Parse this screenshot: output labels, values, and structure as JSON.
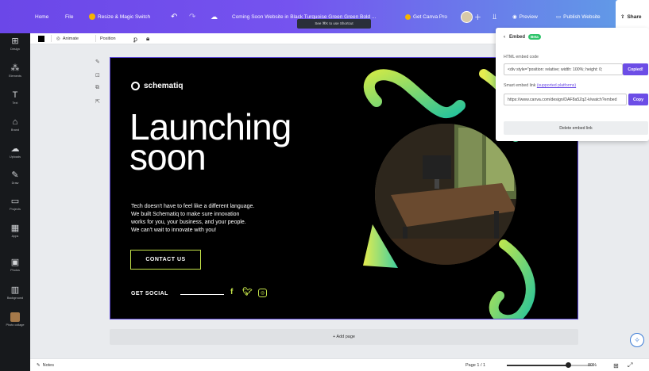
{
  "topbar": {
    "home": "Home",
    "file": "File",
    "resize": "Resize & Magic Switch",
    "title": "Coming Soon Website in Black Turquoise Green Green Bold ...",
    "canva_pro": "Get Canva Pro",
    "preview": "Preview",
    "publish": "Publish Website",
    "share": "Share",
    "tooltip": "See ⌘K to use Shortcut",
    "colors": {
      "start": "#6b47e8",
      "end": "#5fa0e6"
    }
  },
  "sidebar": {
    "items": [
      {
        "label": "Design",
        "icon": "design-icon",
        "glyph": "⊞"
      },
      {
        "label": "Elements",
        "icon": "elements-icon",
        "glyph": "⁂"
      },
      {
        "label": "Text",
        "icon": "text-icon",
        "glyph": "T"
      },
      {
        "label": "Brand",
        "icon": "brand-icon",
        "glyph": "⌂"
      },
      {
        "label": "Uploads",
        "icon": "uploads-icon",
        "glyph": "☁"
      },
      {
        "label": "Draw",
        "icon": "draw-icon",
        "glyph": "✎"
      },
      {
        "label": "Projects",
        "icon": "projects-icon",
        "glyph": "▭"
      },
      {
        "label": "Apps",
        "icon": "apps-icon",
        "glyph": "▦"
      },
      {
        "label": "Photos",
        "icon": "photos-icon",
        "glyph": "▣"
      },
      {
        "label": "Background",
        "icon": "background-icon",
        "glyph": "▥"
      },
      {
        "label": "Photo collage",
        "icon": "photo-collage-icon",
        "glyph": ""
      }
    ]
  },
  "toolbar": {
    "animate": "Animate",
    "position": "Position",
    "color": "#000000"
  },
  "canvas": {
    "brand": "schematiq",
    "headline": [
      "Launching",
      "soon"
    ],
    "body": [
      "Tech doesn't have to feel like a different language.",
      "We built Schematiq to make sure innovation",
      "works for you, your business, and your people.",
      "We can't wait to innovate with you!"
    ],
    "cta": "CONTACT US",
    "social_label": "GET SOCIAL",
    "accent": "#c5e54a"
  },
  "addpage": "+ Add page",
  "bottombar": {
    "notes": "Notes",
    "page": "Page 1 / 1",
    "zoom": "80%",
    "zoom_fraction": 0.7
  },
  "embed": {
    "title": "Embed",
    "badge": "Beta",
    "html_label": "HTML embed code",
    "html_value": "<div style=\"position: relative; width: 100%; height: 0;",
    "html_button": "Copied!",
    "link_label": "Smart embed link",
    "link_hint": "(supported platforms)",
    "link_value": "https://www.canva.com/design/DAF8a5ZqZ-k/watch?embed",
    "link_button": "Copy",
    "delete": "Delete embed link"
  }
}
